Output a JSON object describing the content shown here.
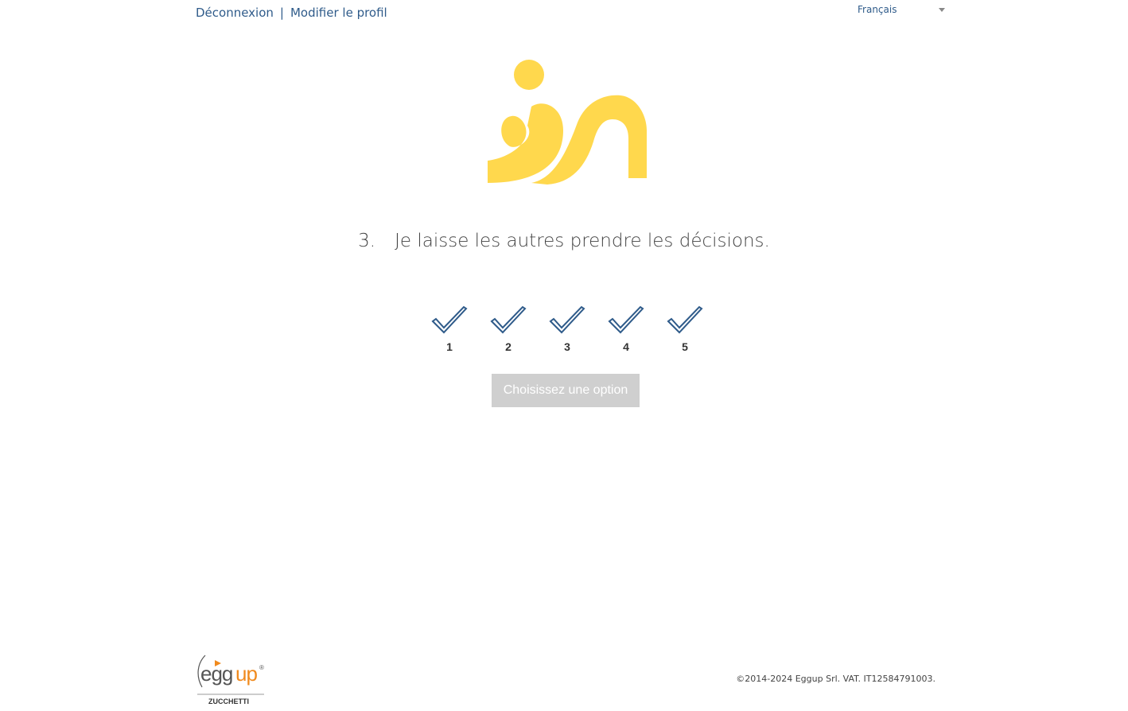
{
  "nav": {
    "logout": "Déconnexion",
    "separator": "|",
    "edit_profile": "Modifier le profil"
  },
  "language": {
    "selected": "Français"
  },
  "question": {
    "number": "3.",
    "text": "Je laisse les autres prendre les décisions."
  },
  "options": [
    "1",
    "2",
    "3",
    "4",
    "5"
  ],
  "submit": {
    "label": "Choisissez une option"
  },
  "footer": {
    "brand": "eggup",
    "registered": "®",
    "subbrand": "ZUCCHETTI",
    "copyright": "©2014-2024 Eggup Srl. VAT. IT12584791003."
  },
  "colors": {
    "logo": "#ffd84d",
    "link": "#2f5b8a",
    "check": "#2f5b8a",
    "button_disabled": "#cfcfcf",
    "brand_orange": "#f08a1e"
  }
}
